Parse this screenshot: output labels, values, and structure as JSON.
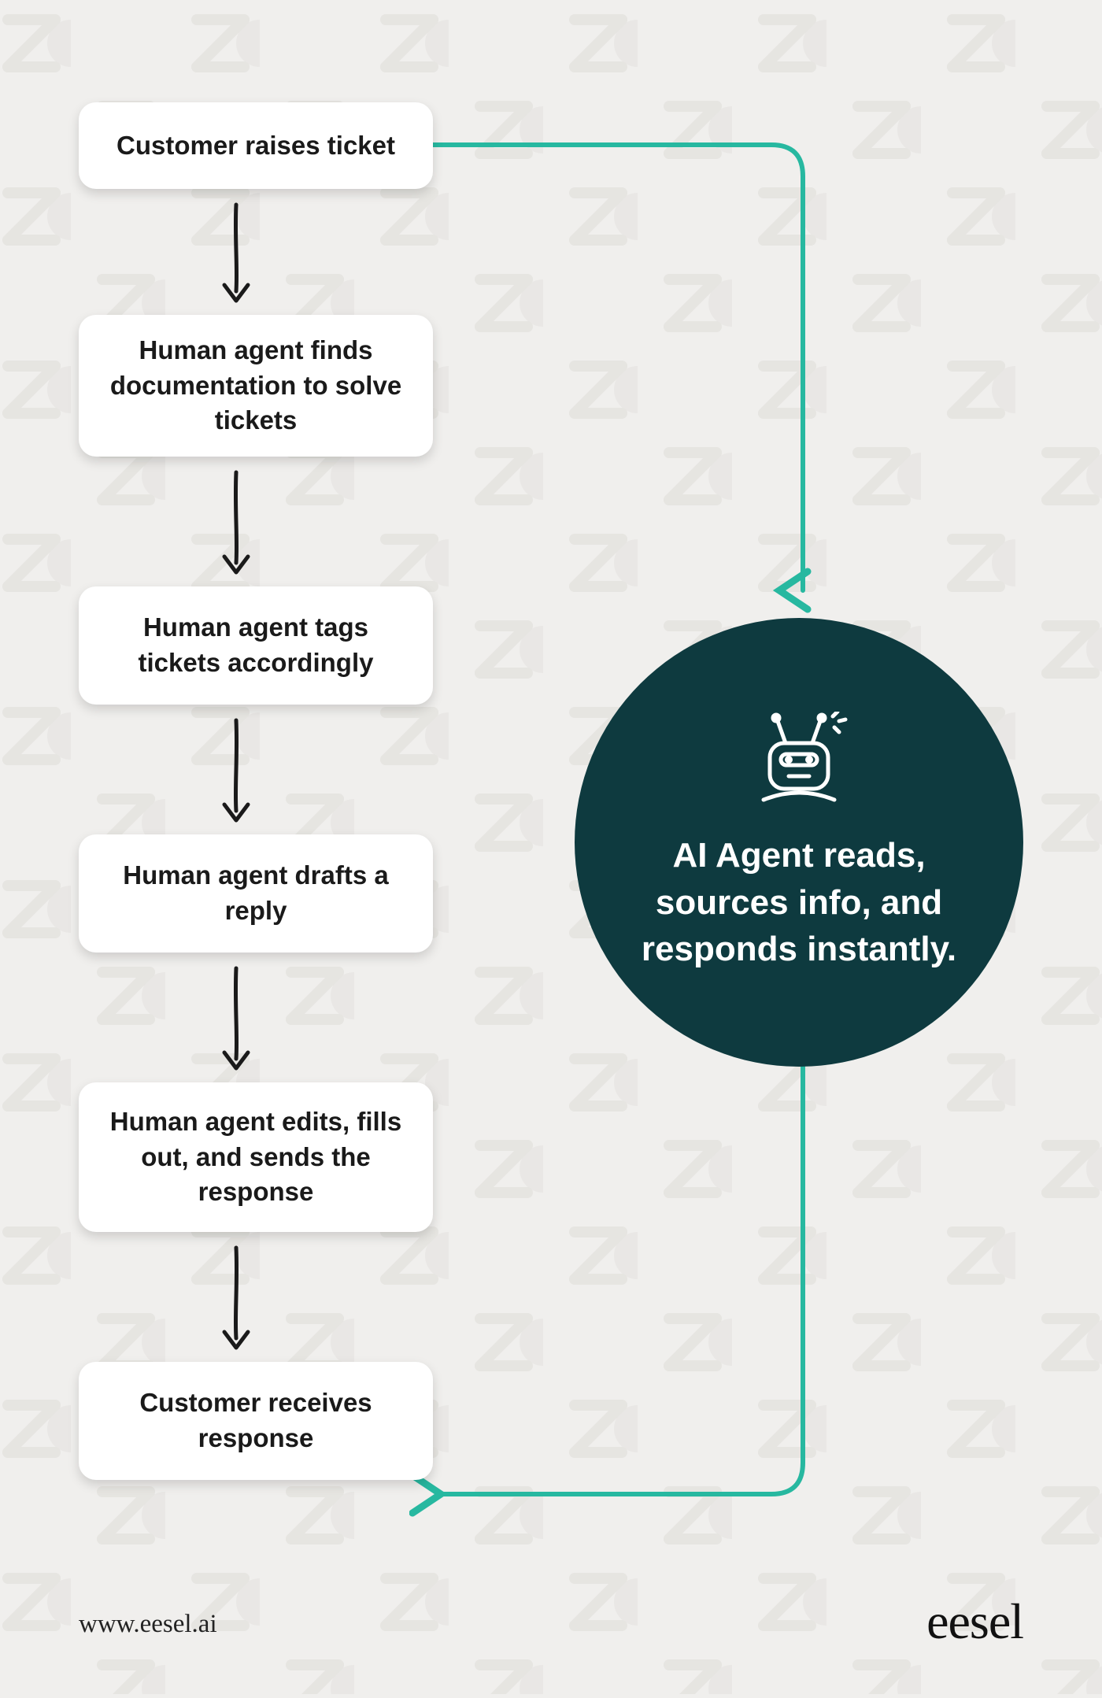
{
  "flow": {
    "steps": [
      {
        "id": "step1",
        "label": "Customer raises ticket"
      },
      {
        "id": "step2",
        "label": "Human agent finds documentation to solve tickets"
      },
      {
        "id": "step3",
        "label": "Human agent tags tickets accordingly"
      },
      {
        "id": "step4",
        "label": "Human agent drafts a reply"
      },
      {
        "id": "step5",
        "label": "Human agent edits, fills out, and sends the response"
      },
      {
        "id": "step6",
        "label": "Customer receives response"
      }
    ],
    "ai_circle": {
      "icon": "robot-icon",
      "text": "AI Agent reads, sources info, and responds instantly."
    }
  },
  "footer": {
    "url": "www.eesel.ai",
    "brand": "eesel"
  },
  "colors": {
    "teal": "#27b8a0",
    "circle_bg": "#0e3a3f",
    "page_bg": "#f0efed"
  }
}
